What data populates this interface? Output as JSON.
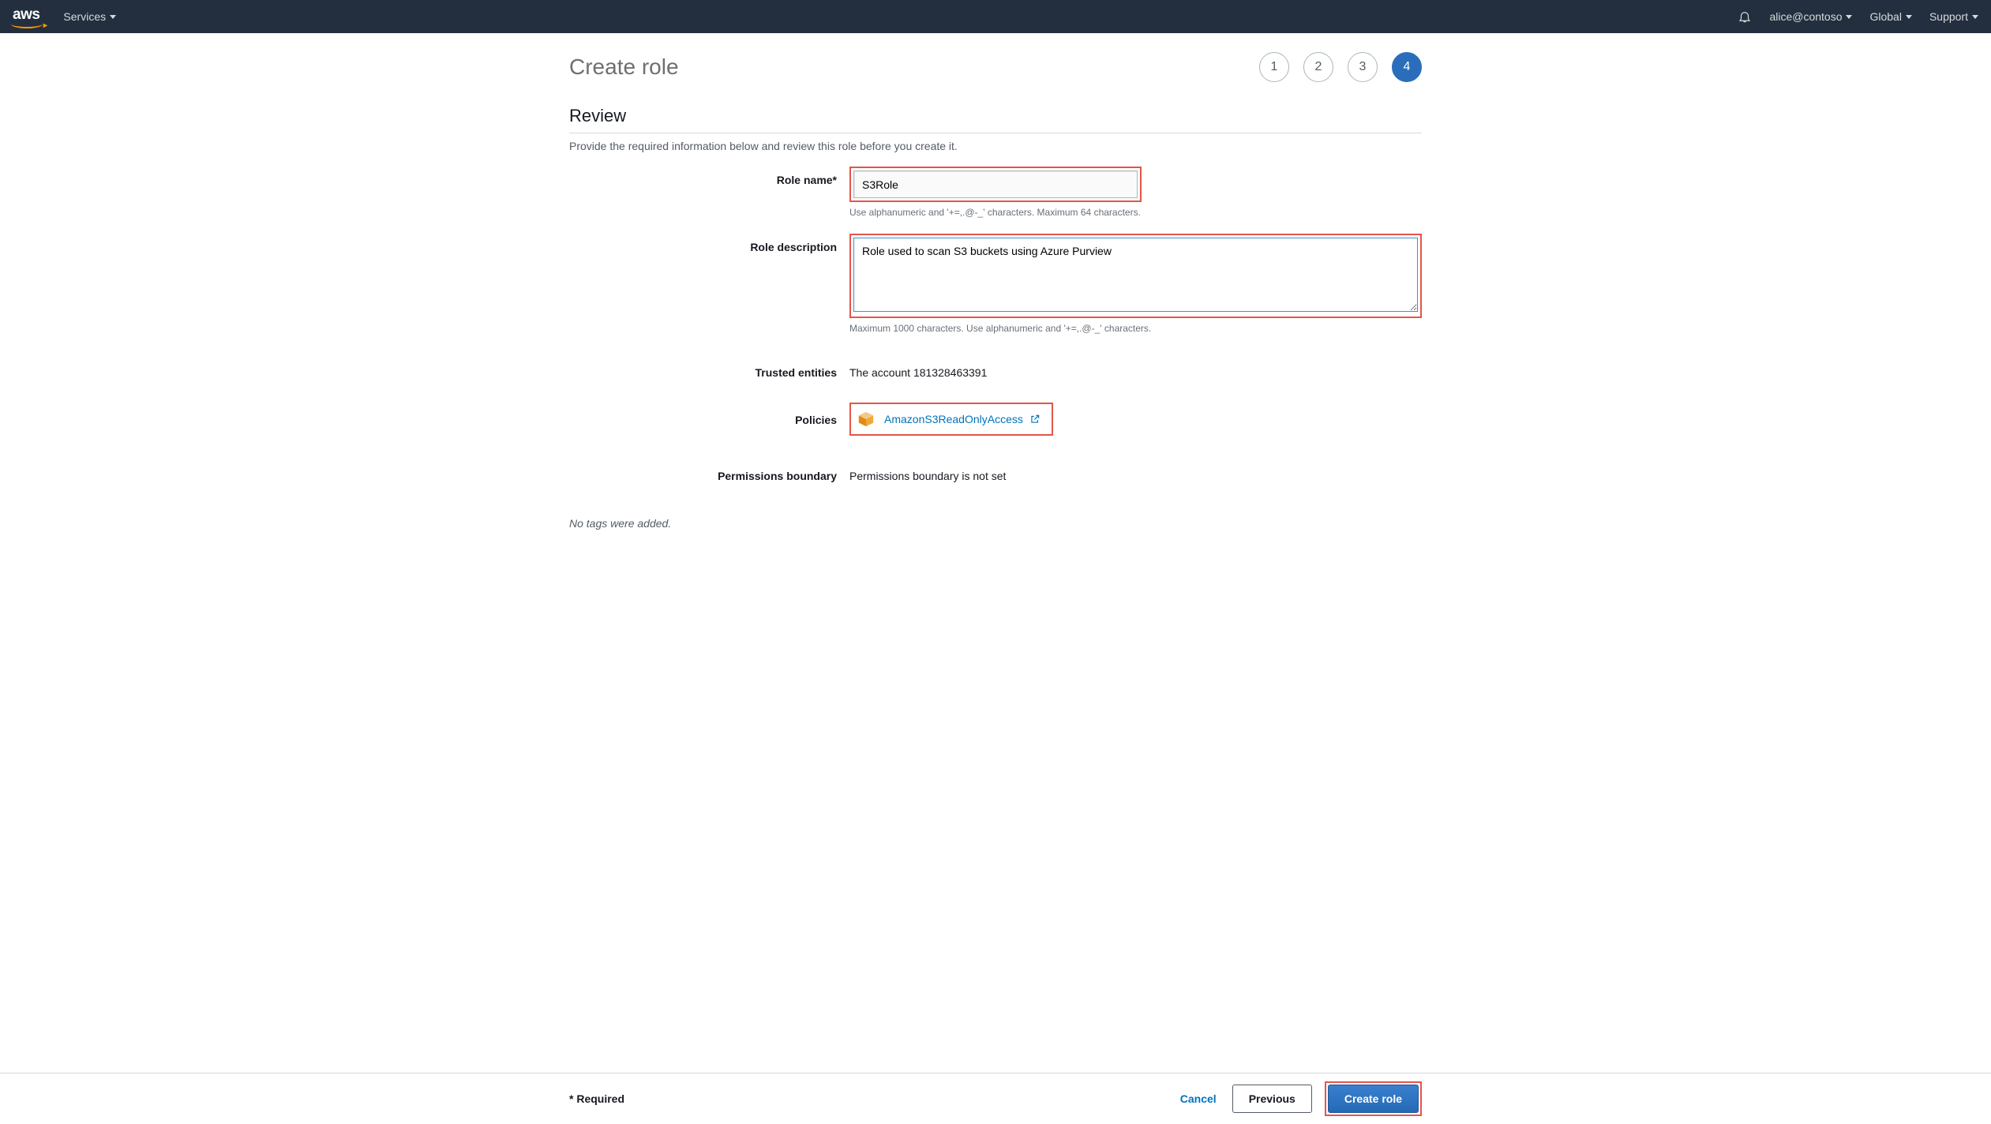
{
  "header": {
    "logo_text": "aws",
    "services_label": "Services",
    "account_label": "alice@contoso",
    "region_label": "Global",
    "support_label": "Support"
  },
  "wizard": {
    "steps": [
      "1",
      "2",
      "3",
      "4"
    ],
    "active_index": 3
  },
  "page": {
    "title": "Create role",
    "section_title": "Review",
    "section_hint": "Provide the required information below and review this role before you create it."
  },
  "form": {
    "role_name_label": "Role name*",
    "role_name_value": "S3Role",
    "role_name_hint": "Use alphanumeric and '+=,.@-_' characters. Maximum 64 characters.",
    "role_desc_label": "Role description",
    "role_desc_value": "Role used to scan S3 buckets using Azure Purview",
    "role_desc_hint": "Maximum 1000 characters. Use alphanumeric and '+=,.@-_' characters.",
    "trusted_label": "Trusted entities",
    "trusted_value": "The account 181328463391",
    "policies_label": "Policies",
    "policy_name": "AmazonS3ReadOnlyAccess",
    "perm_boundary_label": "Permissions boundary",
    "perm_boundary_value": "Permissions boundary is not set",
    "no_tags": "No tags were added."
  },
  "footer": {
    "required_note": "* Required",
    "cancel": "Cancel",
    "previous": "Previous",
    "create": "Create role"
  }
}
